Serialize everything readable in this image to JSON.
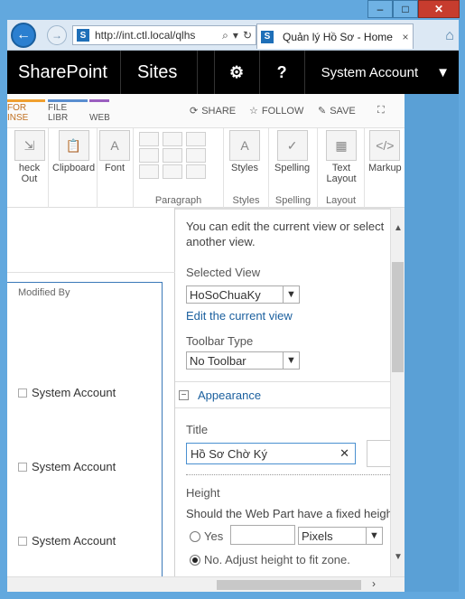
{
  "window": {
    "controls": [
      "–",
      "□",
      "✕"
    ]
  },
  "browser": {
    "url": "http://int.ctl.local/qlhs",
    "tab_title": "Quản lý Hồ Sơ - Home",
    "sp_glyph": "S"
  },
  "suite_bar": {
    "brand": "SharePoint",
    "sites": "Sites",
    "settings_glyph": "⚙",
    "help_glyph": "?",
    "account": "System Account",
    "account_caret": "▼"
  },
  "ribbon_tabs": {
    "tabs": [
      "FOR INSE",
      "FILE LIBR",
      "WEB"
    ],
    "share": "SHARE",
    "follow": "FOLLOW",
    "save": "SAVE"
  },
  "ribbon": {
    "check_out": "heck Out",
    "clipboard": "Clipboard",
    "font": "Font",
    "paragraph": "Paragraph",
    "styles": "Styles",
    "styles_group": "Styles",
    "spelling": "Spelling",
    "spelling_group": "Spelling",
    "text_layout": "Text Layout",
    "layout_group": "Layout",
    "markup": "Markup"
  },
  "content": {
    "modified_by_header": "Modified By",
    "rows": [
      "System Account",
      "System Account",
      "System Account"
    ]
  },
  "tool_pane": {
    "intro": "You can edit the current view or select another view.",
    "selected_view_label": "Selected View",
    "selected_view_value": "HoSoChuaKy",
    "edit_view_link": "Edit the current view",
    "toolbar_type_label": "Toolbar Type",
    "toolbar_type_value": "No Toolbar",
    "appearance_section": "Appearance",
    "title_label": "Title",
    "title_value": "Hồ Sơ Chờ Ký",
    "height_label": "Height",
    "height_question": "Should the Web Part have a fixed heigh",
    "yes_label": "Yes",
    "pixels_value": "Pixels",
    "no_label": "No. Adjust height to fit zone."
  }
}
